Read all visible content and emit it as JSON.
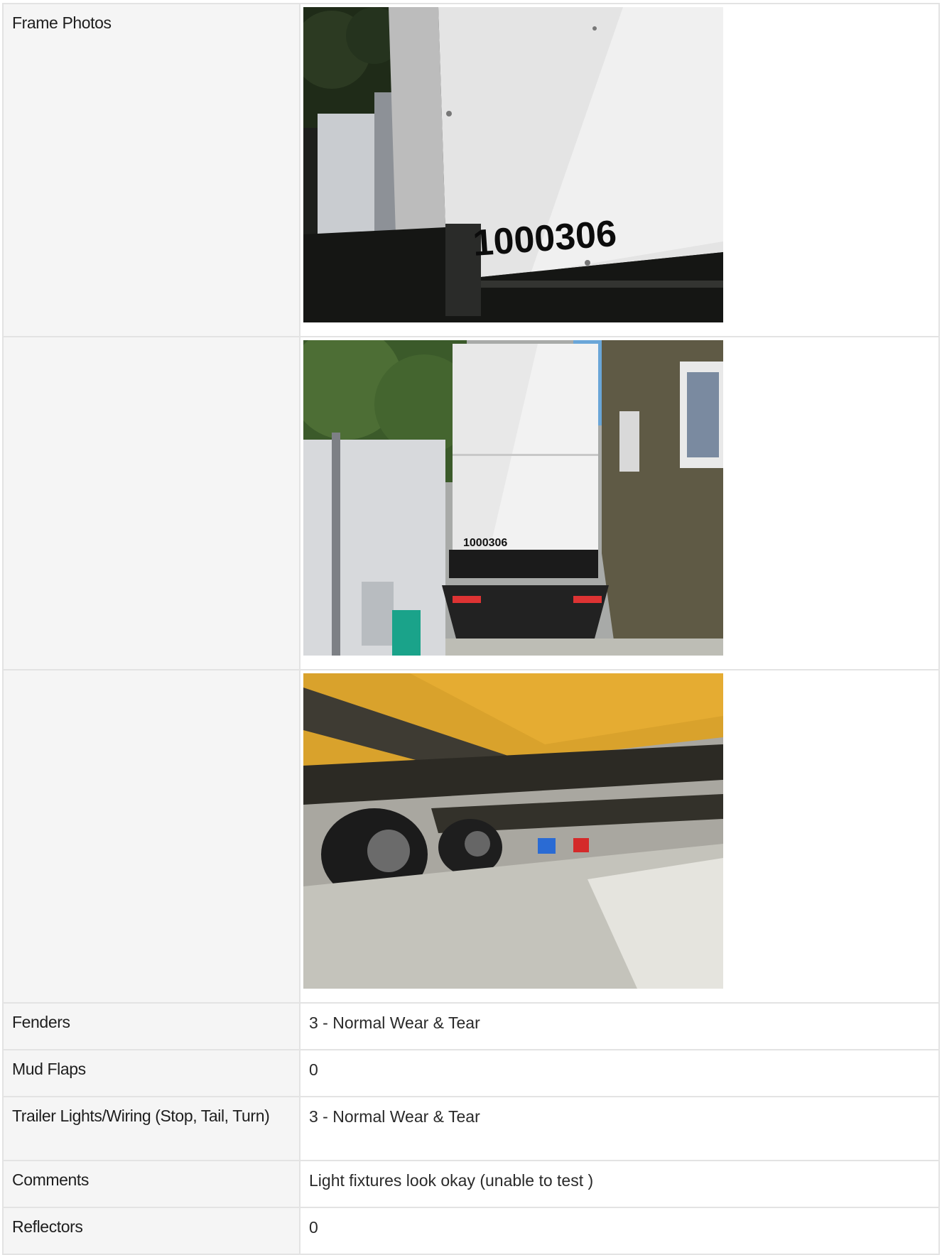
{
  "rows": {
    "frame_photos": {
      "label": "Frame Photos",
      "photos": [
        {
          "number_text": "1000306"
        },
        {
          "number_text": "1000306"
        },
        {}
      ]
    },
    "fenders": {
      "label": "Fenders",
      "value": "3 - Normal Wear & Tear"
    },
    "mud_flaps": {
      "label": "Mud Flaps",
      "value": "0"
    },
    "trailer_lights": {
      "label": "Trailer Lights/Wiring (Stop, Tail, Turn)",
      "value": "3 - Normal Wear & Tear"
    },
    "comments": {
      "label": "Comments",
      "value": "Light fixtures look okay (unable to test )"
    },
    "reflectors": {
      "label": "Reflectors",
      "value": "0"
    }
  },
  "colors": {
    "label_bg": "#f5f5f5",
    "border": "#e3e3e3",
    "generator_white": "#e6e6e6",
    "undercarriage_yellow": "#e0a92a"
  }
}
